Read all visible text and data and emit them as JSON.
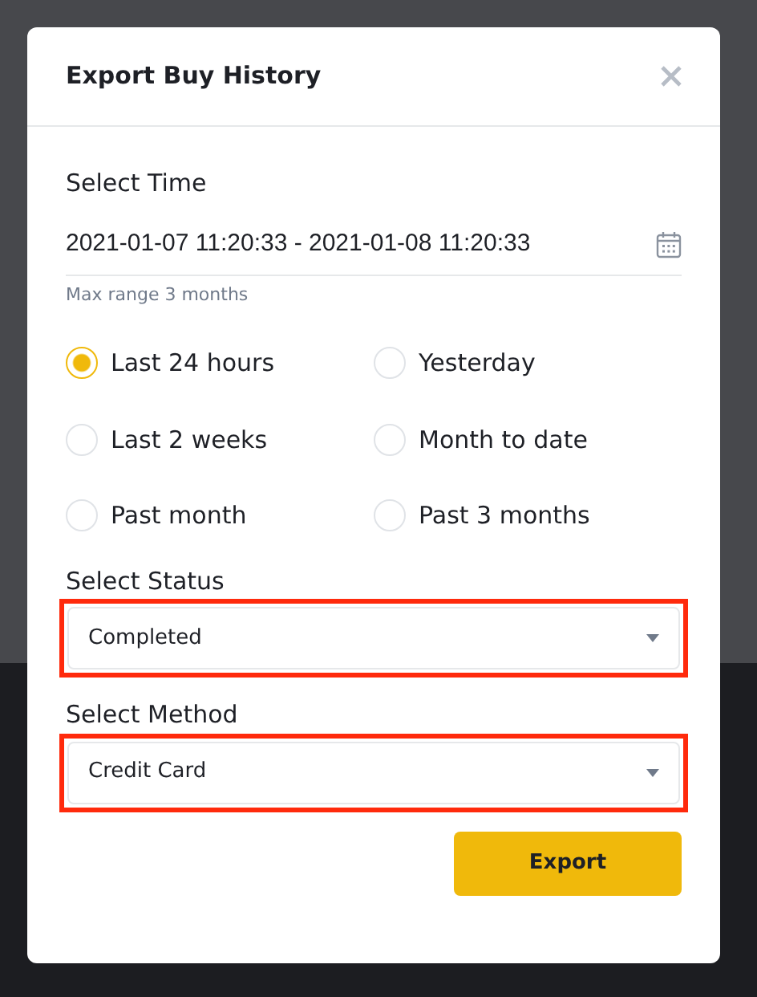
{
  "dialog": {
    "title": "Export Buy History",
    "time": {
      "label": "Select Time",
      "value": "2021-01-07 11:20:33 - 2021-01-08 11:20:33",
      "hint": "Max range 3 months"
    },
    "ranges": [
      {
        "label": "Last 24 hours",
        "selected": true
      },
      {
        "label": "Yesterday",
        "selected": false
      },
      {
        "label": "Last 2 weeks",
        "selected": false
      },
      {
        "label": "Month to date",
        "selected": false
      },
      {
        "label": "Past month",
        "selected": false
      },
      {
        "label": "Past 3 months",
        "selected": false
      }
    ],
    "selects": [
      {
        "label": "Select Status",
        "value": "Completed",
        "highlighted": true
      },
      {
        "label": "Select Method",
        "value": "Credit Card",
        "highlighted": true
      }
    ],
    "export_button": "Export"
  }
}
